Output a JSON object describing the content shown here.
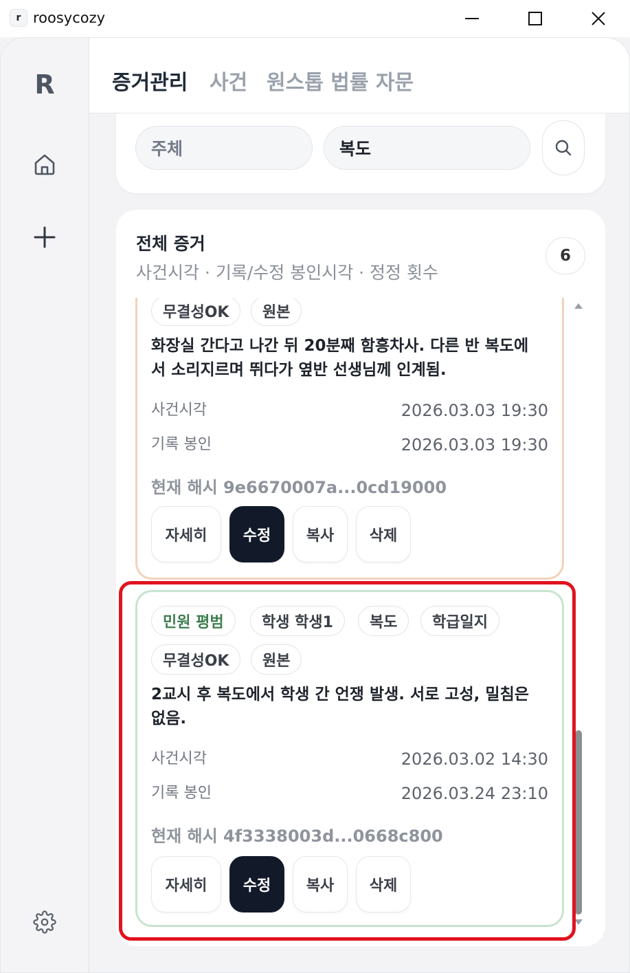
{
  "window": {
    "app_icon_letter": "r",
    "title": "roosycozy"
  },
  "sidebar": {
    "logo": "R",
    "items": [
      {
        "icon": "home-icon"
      },
      {
        "icon": "plus-icon"
      },
      {
        "icon": "gear-icon"
      }
    ]
  },
  "header": {
    "tabs": [
      {
        "label": "증거관리",
        "active": true
      },
      {
        "label": "사건",
        "active": false
      },
      {
        "label": "원스톱 법률 자문",
        "active": false
      }
    ]
  },
  "search": {
    "subject_placeholder": "주체",
    "location_value": "복도",
    "search_icon": "search-icon"
  },
  "evidence": {
    "title": "전체 증거",
    "subtitle": "사건시각 · 기록/수정 봉인시각 · 정정 횟수",
    "count": "6",
    "cards": [
      {
        "chips": [
          "무결성OK",
          "원본"
        ],
        "text": "화장실 간다고 나간 뒤 20분째 함흥차사. 다른 반 복도에서 소리지르며 뛰다가 옆반 선생님께 인계됨.",
        "event_time_label": "사건시각",
        "event_time": "2026.03.03  19:30",
        "seal_label": "기록 봉인",
        "seal_time": "2026.03.03  19:30",
        "hash": "현재 해시 9e6670007a...0cd19000",
        "accent": "#f4d2ba"
      },
      {
        "chips": [
          "민원 평범",
          "학생 학생1",
          "복도",
          "학급일지",
          "무결성OK",
          "원본"
        ],
        "text": "2교시 후 복도에서 학생 간 언쟁 발생. 서로 고성, 밀침은 없음.",
        "event_time_label": "사건시각",
        "event_time": "2026.03.02  14:30",
        "seal_label": "기록 봉인",
        "seal_time": "2026.03.24  23:10",
        "hash": "현재 해시 4f3338003d...0668c800",
        "accent": "#c8e4cf"
      }
    ],
    "actions": {
      "detail": "자세히",
      "edit": "수정",
      "copy": "복사",
      "delete": "삭제"
    }
  },
  "colors": {
    "primary_button": "#121a2a",
    "highlight": "#e0141f",
    "complaint_chip": "#3e7d4f"
  }
}
